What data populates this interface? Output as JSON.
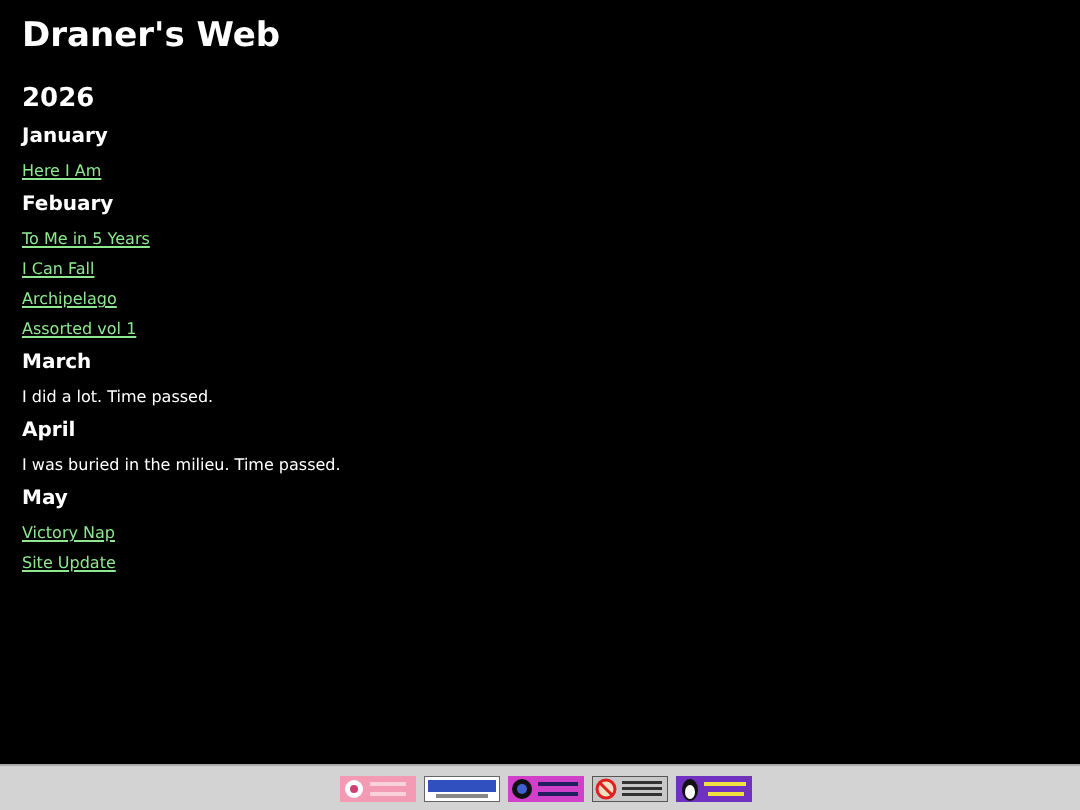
{
  "title": "Draner's Web",
  "year": "2026",
  "months": [
    {
      "name": "January",
      "entries": [
        {
          "kind": "link",
          "text": "Here I Am"
        }
      ]
    },
    {
      "name": "Febuary",
      "entries": [
        {
          "kind": "link",
          "text": "To Me in 5 Years"
        },
        {
          "kind": "link",
          "text": "I Can Fall"
        },
        {
          "kind": "link",
          "text": "Archipelago"
        },
        {
          "kind": "link",
          "text": "Assorted vol 1"
        }
      ]
    },
    {
      "name": "March",
      "entries": [
        {
          "kind": "text",
          "text": "I did a lot. Time passed."
        }
      ]
    },
    {
      "name": "April",
      "entries": [
        {
          "kind": "text",
          "text": "I was buried in the milieu. Time passed."
        }
      ]
    },
    {
      "name": "May",
      "entries": [
        {
          "kind": "link",
          "text": "Victory Nap"
        },
        {
          "kind": "link",
          "text": "Site Update"
        }
      ]
    }
  ],
  "badges": [
    {
      "kind": "flower"
    },
    {
      "kind": "html"
    },
    {
      "kind": "github"
    },
    {
      "kind": "no-cookie"
    },
    {
      "kind": "penguin"
    }
  ]
}
